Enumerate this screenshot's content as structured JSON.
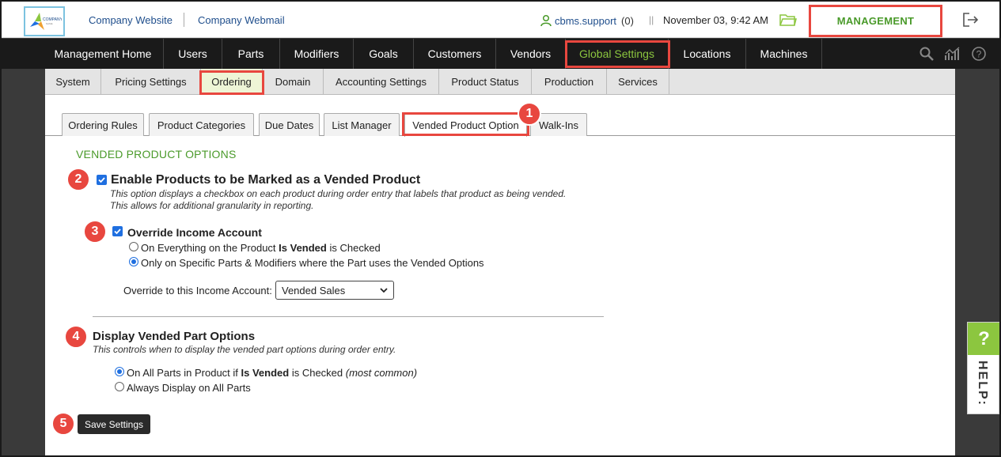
{
  "topbar": {
    "links": [
      "Company Website",
      "Company Webmail"
    ],
    "user_name": "cbms.support",
    "user_count": "(0)",
    "separator": "||",
    "datetime": "November 03, 9:42 AM",
    "management_label": "MANAGEMENT"
  },
  "mainnav": {
    "items": [
      "Management Home",
      "Users",
      "Parts",
      "Modifiers",
      "Goals",
      "Customers",
      "Vendors",
      "Global Settings",
      "Locations",
      "Machines"
    ],
    "active": "Global Settings"
  },
  "subnav": {
    "items": [
      "System",
      "Pricing Settings",
      "Ordering",
      "Domain",
      "Accounting Settings",
      "Product Status",
      "Production",
      "Services"
    ],
    "active": "Ordering"
  },
  "tabs": {
    "items": [
      "Ordering Rules",
      "Product Categories",
      "Due Dates",
      "List Manager",
      "Vended Product Option",
      "Walk-Ins"
    ],
    "active": "Vended Product Option"
  },
  "badges": [
    "1",
    "2",
    "3",
    "4",
    "5"
  ],
  "content": {
    "section_title": "VENDED PRODUCT OPTIONS",
    "enable_label": "Enable Products to be Marked as a Vended Product",
    "enable_desc_1": "This option displays a checkbox on each product during order entry that labels that product as being vended.",
    "enable_desc_2": "This allows for additional granularity in reporting.",
    "override_label": "Override Income Account",
    "override_opt1_pre": "On Everything on the Product ",
    "override_opt1_bold": "Is Vended",
    "override_opt1_post": " is Checked",
    "override_opt2": "Only on Specific Parts & Modifiers where the Part uses the Vended Options",
    "income_label": "Override to this Income Account:",
    "income_value": "Vended Sales",
    "display_label": "Display Vended Part Options",
    "display_desc": "This controls when to display the vended part options during order entry.",
    "display_opt1_pre": "On All Parts in Product if ",
    "display_opt1_bold": "Is Vended",
    "display_opt1_post": " is Checked ",
    "display_opt1_note": "(most common)",
    "display_opt2": "Always Display on All Parts",
    "save_label": "Save Settings"
  },
  "help": {
    "icon": "?",
    "label": "HELP:"
  },
  "colors": {
    "accent_green": "#8cc63f",
    "highlight_red": "#e8473f",
    "link_blue": "#1f4e8c",
    "nav_bg": "#1a1a1a"
  }
}
